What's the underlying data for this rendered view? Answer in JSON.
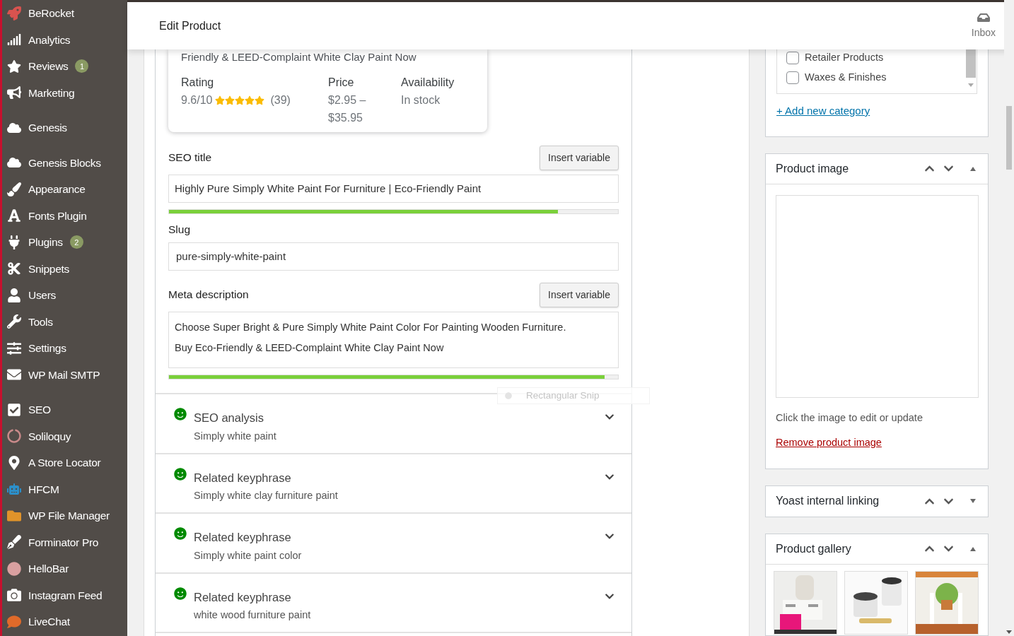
{
  "sidebar": {
    "groups": [
      {
        "items": [
          {
            "label": "BeRocket"
          },
          {
            "label": "Analytics"
          },
          {
            "label": "Reviews",
            "badge": "1"
          },
          {
            "label": "Marketing"
          }
        ]
      },
      {
        "items": [
          {
            "label": "Genesis"
          }
        ]
      },
      {
        "items": [
          {
            "label": "Genesis Blocks"
          },
          {
            "label": "Appearance"
          },
          {
            "label": "Fonts Plugin"
          },
          {
            "label": "Plugins",
            "badge": "2"
          },
          {
            "label": "Snippets"
          },
          {
            "label": "Users"
          },
          {
            "label": "Tools"
          },
          {
            "label": "Settings"
          },
          {
            "label": "WP Mail SMTP"
          }
        ]
      },
      {
        "items": [
          {
            "label": "SEO"
          },
          {
            "label": "Soliloquy"
          },
          {
            "label": "A Store Locator"
          },
          {
            "label": "HFCM"
          },
          {
            "label": "WP File Manager"
          },
          {
            "label": "Forminator Pro"
          },
          {
            "label": "HelloBar"
          },
          {
            "label": "Instagram Feed"
          },
          {
            "label": "LiveChat"
          }
        ]
      }
    ]
  },
  "header": {
    "title": "Edit Product",
    "inbox_label": "Inbox"
  },
  "snippet_preview": {
    "description_tail": "Friendly & LEED-Complaint White Clay Paint Now",
    "rating_label": "Rating",
    "rating": "9.6/10",
    "stars": 5,
    "review_count": "(39)",
    "price_label": "Price",
    "price": "$2.95 – $35.95",
    "availability_label": "Availability",
    "availability": "In stock"
  },
  "seo_title": {
    "label": "SEO title",
    "button": "Insert variable",
    "value": "Highly Pure Simply White Paint For Furniture | Eco-Friendly Paint",
    "level": 0.866
  },
  "slug": {
    "label": "Slug",
    "value": "pure-simply-white-paint"
  },
  "meta_description": {
    "label": "Meta description",
    "button": "Insert variable",
    "value": "Choose Super Bright & Pure Simply White Paint Color For Painting Wooden Furniture. Buy Eco-Friendly & LEED-Complaint White Clay Paint Now",
    "level": 0.97
  },
  "tooltip": {
    "text": "Rectangular Snip"
  },
  "analysis_sections": [
    {
      "title": "SEO analysis",
      "keyphrase": "Simply white paint",
      "expanded": false
    },
    {
      "title": "Related keyphrase",
      "keyphrase": "Simply white clay furniture paint",
      "expanded": false
    },
    {
      "title": "Related keyphrase",
      "keyphrase": "Simply white paint color",
      "expanded": false
    },
    {
      "title": "Related keyphrase",
      "keyphrase": "white wood furniture paint",
      "expanded": false
    }
  ],
  "categories": {
    "items": [
      {
        "label": "Retailer Products",
        "checked": false
      },
      {
        "label": "Waxes & Finishes",
        "checked": false
      }
    ],
    "add_link": "+ Add new category"
  },
  "product_image": {
    "title": "Product image",
    "expanded": true,
    "hint": "Click the image to edit or update",
    "remove_link": "Remove product image"
  },
  "yoast_linking": {
    "title": "Yoast internal linking",
    "expanded": false
  },
  "product_gallery": {
    "title": "Product gallery",
    "expanded": true
  }
}
